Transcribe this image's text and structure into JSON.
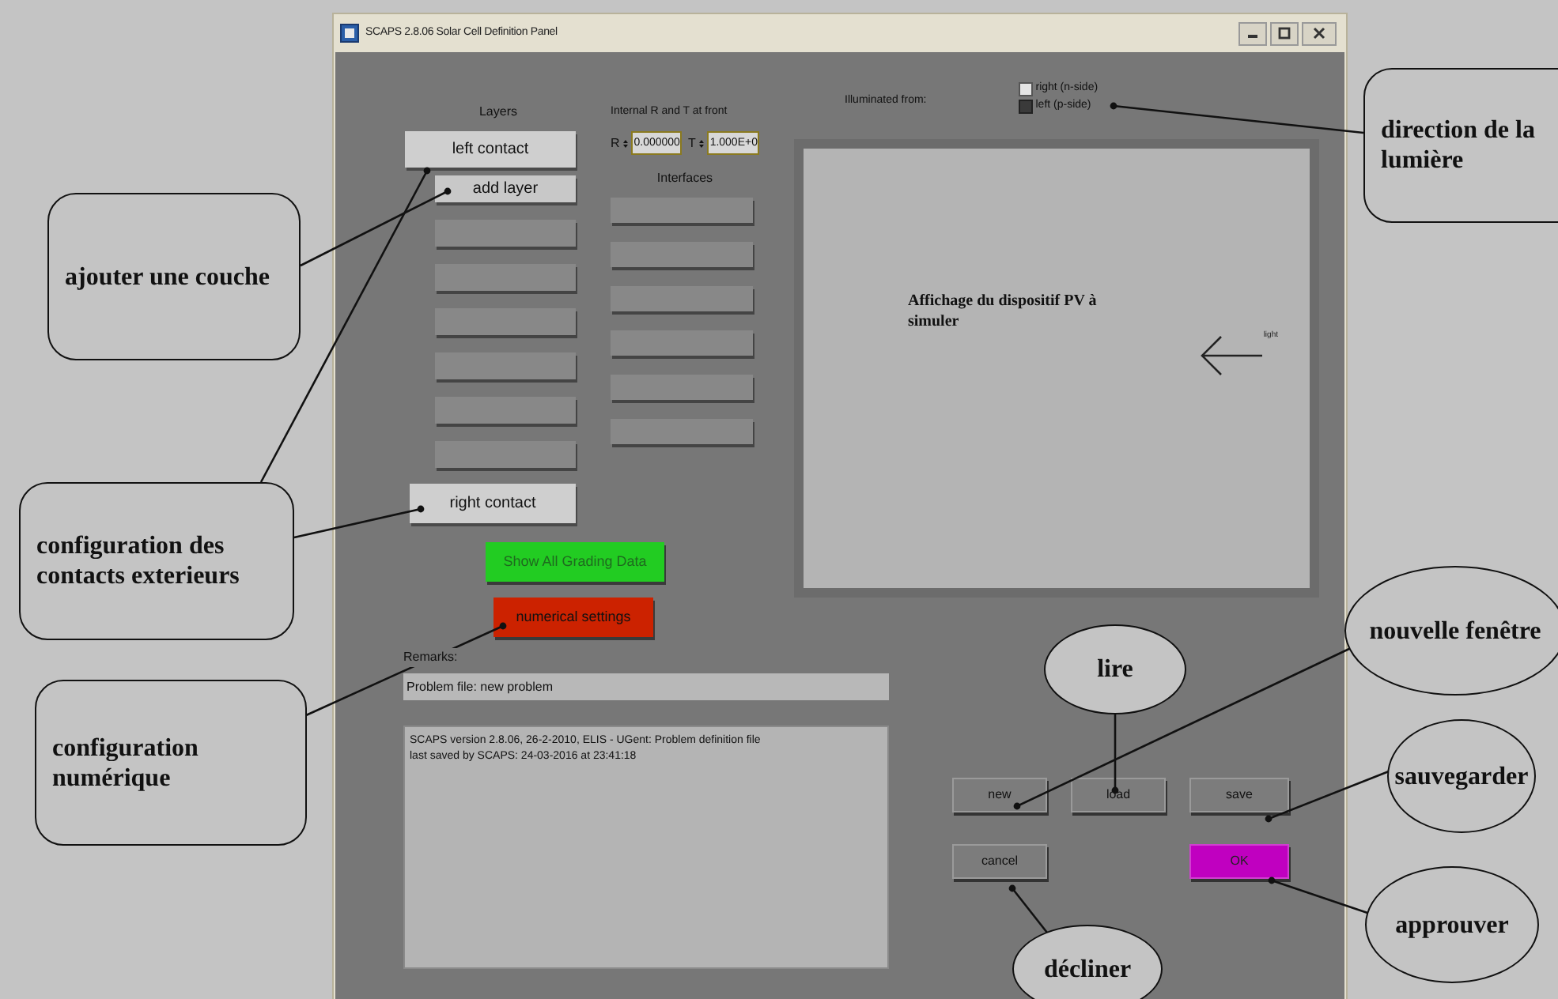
{
  "window": {
    "title": "SCAPS 2.8.06 Solar Cell Definition Panel"
  },
  "layers": {
    "heading": "Layers",
    "left_contact": "left contact",
    "add_layer": "add layer",
    "right_contact": "right contact"
  },
  "internal_rt": {
    "heading": "Internal R and T at front",
    "r_label": "R",
    "r_value": "0.000000",
    "t_label": "T",
    "t_value": "1.000E+0"
  },
  "interfaces": {
    "heading": "Interfaces"
  },
  "illumination": {
    "label": "Illuminated from:",
    "options": [
      {
        "label": "right (n-side)",
        "selected": false
      },
      {
        "label": "left (p-side)",
        "selected": true
      }
    ]
  },
  "display": {
    "text": "Affichage du dispositif PV à simuler",
    "arrow_label": "light"
  },
  "grading_button": "Show All Grading Data",
  "numerical_button": "numerical settings",
  "remarks": {
    "label": "Remarks:",
    "value": "Problem file: new problem",
    "notes": [
      "SCAPS version 2.8.06, 26-2-2010, ELIS - UGent: Problem definition file",
      "last saved by SCAPS: 24-03-2016 at 23:41:18"
    ]
  },
  "buttons": [
    {
      "label": "new",
      "kind": "plain"
    },
    {
      "label": "load",
      "kind": "plain"
    },
    {
      "label": "save",
      "kind": "plain"
    },
    {
      "label": "cancel",
      "kind": "plain"
    },
    {
      "label": "OK",
      "kind": "primary"
    }
  ],
  "annotations": [
    {
      "text": "ajouter une couche",
      "kind": "box"
    },
    {
      "text": "configuration des contacts exterieurs",
      "kind": "box"
    },
    {
      "text": "configuration numérique",
      "kind": "box"
    },
    {
      "text": "direction de la lumière",
      "kind": "box"
    },
    {
      "text": "nouvelle fenêtre",
      "kind": "ellipse"
    },
    {
      "text": "lire",
      "kind": "ellipse"
    },
    {
      "text": "sauvegarder",
      "kind": "ellipse"
    },
    {
      "text": "approuver",
      "kind": "ellipse"
    },
    {
      "text": "décliner",
      "kind": "ellipse"
    }
  ]
}
